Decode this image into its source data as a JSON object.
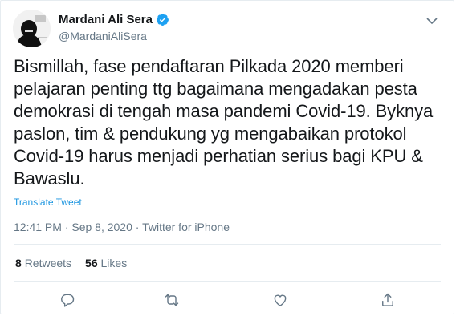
{
  "author": {
    "display_name": "Mardani Ali Sera",
    "handle": "@MardaniAliSera",
    "verified": true,
    "verified_color": "#1da1f2"
  },
  "tweet": {
    "text": "Bismillah, fase pendaftaran Pilkada 2020 memberi\npelajaran penting ttg bagaimana mengadakan pesta\ndemokrasi di tengah masa pandemi Covid-19. Byknya\npaslon, tim & pendukung yg mengabaikan protokol\nCovid-19 harus menjadi perhatian serius bagi KPU &\nBawaslu.",
    "translate_label": "Translate Tweet",
    "timestamp": "12:41 PM · Sep 8, 2020 · Twitter for iPhone"
  },
  "stats": {
    "retweets_count": "8",
    "retweets_label": "Retweets",
    "likes_count": "56",
    "likes_label": "Likes"
  },
  "icons": {
    "more": "chevron-down-icon",
    "reply": "reply-icon",
    "retweet": "retweet-icon",
    "like": "heart-icon",
    "share": "share-icon"
  },
  "colors": {
    "link": "#1b95e0",
    "secondary_text": "#657786",
    "icon_gray": "#657786",
    "border": "#e6ecf0"
  }
}
